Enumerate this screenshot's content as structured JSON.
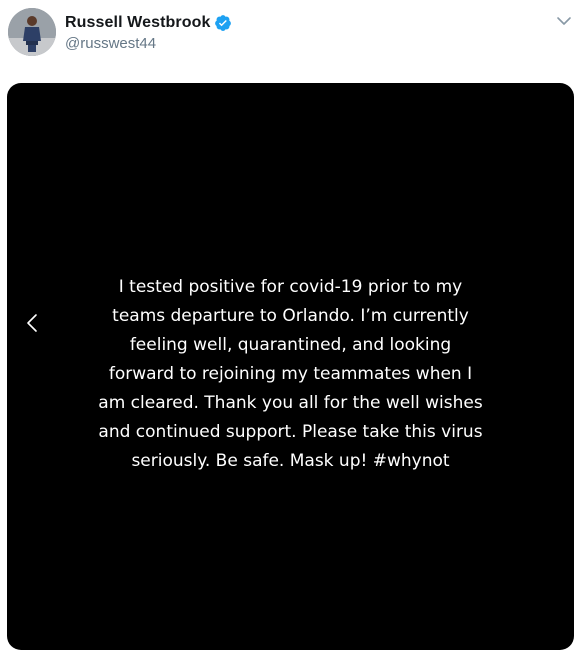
{
  "tweet": {
    "author": {
      "display_name": "Russell Westbrook",
      "handle": "@russwest44",
      "verified_icon": "verified-badge-icon",
      "avatar": "profile-avatar"
    },
    "menu_icon": "chevron-down-icon",
    "media": {
      "text": "I tested positive for covid-19 prior to my\nteams departure to Orlando. I’m currently\nfeeling well, quarantined, and looking\nforward to rejoining my teammates when I\nam cleared. Thank you all for the well wishes\nand continued support. Please take this virus\nseriously. Be safe. Mask up! #whynot",
      "background_color": "#000000",
      "text_color": "#ffffff",
      "nav_icon": "chevron-left-icon"
    }
  },
  "colors": {
    "verified": "#1da1f2",
    "handle": "#657786",
    "name": "#14171a"
  }
}
